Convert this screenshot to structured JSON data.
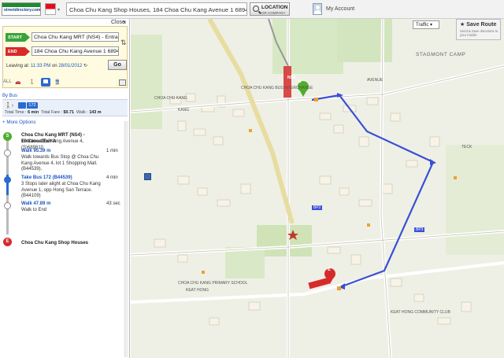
{
  "header": {
    "logo_text": "streetdirectory.com",
    "search_value": "Choa Chu Kang Shop Houses, 184 Choa Chu Kang Avenue 1 689463",
    "location_label": "LOCATION",
    "location_sub": "OR COMPANY",
    "account_label": "My Account"
  },
  "panel": {
    "close_label": "Close",
    "start_tag": "START",
    "end_tag": "END",
    "start_value": "Choa Chu Kang MRT (NS4) - Entrar",
    "end_value": "184 Choa Chu Kang Avenue 1 6894",
    "leaving_label": "Leaving at:",
    "leaving_time": "11:33 PM",
    "leaving_on": "on",
    "leaving_date": "28/01/2012",
    "go_label": "Go",
    "mode_all": "ALL",
    "by_bus": "By Bus",
    "bus_number": "172",
    "total_time_label": "Total Time :",
    "total_time": "6 min",
    "total_fare_label": "Total Fare :",
    "total_fare": "$0.71",
    "walk_label": "Walk :",
    "walk_value": "143 m",
    "more_options": "+ More Options",
    "steps": [
      {
        "title": "Choa Chu Kang MRT (NS4) - Entrance/Exit A",
        "sub": "10 Choa Chu Kang Avenue 4, (S)689810"
      },
      {
        "title": "Walk 95.39 m",
        "sub": "Walk towards Bus Stop @ Choa Chu Kang Avenue 4, lot 1 Shopping Mall. (B44539).",
        "dur": "1 min"
      },
      {
        "title": "Take Bus 172 (B44539)",
        "sub": "3 Stops later alight at Choa Chu Kang Avenue 1, opp Hong San Terrace. (B44109)",
        "dur": "4 min"
      },
      {
        "title": "Walk 47.89 m",
        "sub": "Walk to End",
        "dur": "43 sec"
      },
      {
        "title": "Choa Chu Kang Shop Houses"
      }
    ]
  },
  "map": {
    "traffic_label": "Traffic",
    "save_route_label": "Save Route",
    "save_route_sub": "Send & Save directions to your mobile",
    "labels": {
      "stagmont": "STAGMONT CAMP",
      "ns4": "NS4",
      "bp2": "BP2",
      "bp3": "BP3",
      "choa_chu_kang": "CHOA CHU KANG",
      "keat_hong": "KEAT HONG",
      "kang": "KANG",
      "teck": "TECK",
      "avenue": "AVENUE",
      "cck_primary": "CHOA CHU KANG PRIMARY SCHOOL",
      "keat_hong_cc": "KEAT HONG COMMUNITY CLUB",
      "cck_bus": "CHOA CHU KANG BUS INTERCHANGE",
      "end_marker": "E",
      "start_marker": "S"
    },
    "colors": {
      "route": "#3b4fd6",
      "start": "#4fae2a",
      "end": "#d62b2b"
    }
  }
}
